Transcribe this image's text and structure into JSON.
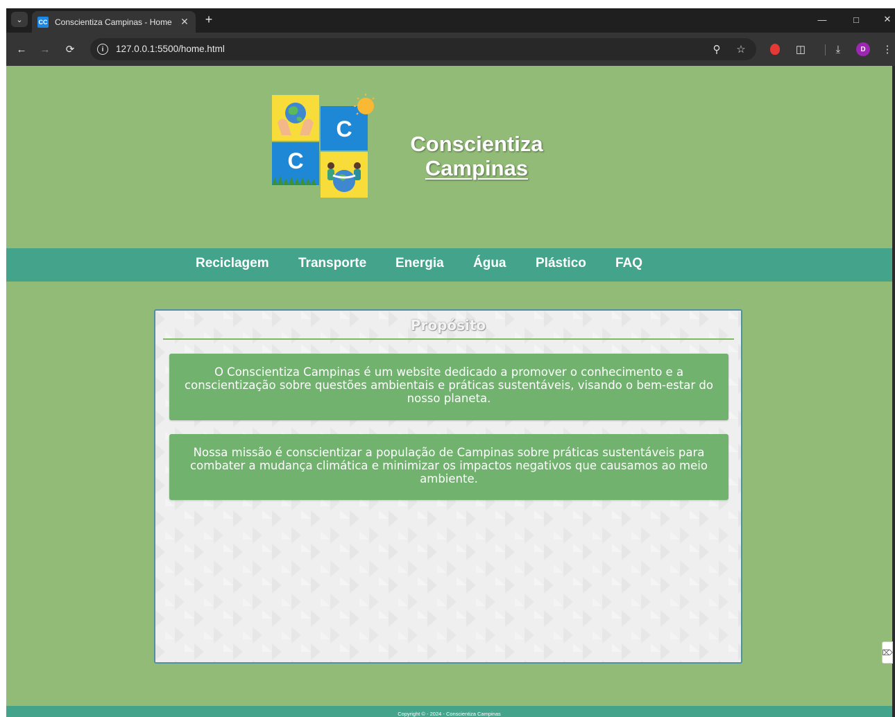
{
  "browser": {
    "tab_title": "Conscientiza Campinas - Home",
    "favicon_text": "CC",
    "url": "127.0.0.1:5500/home.html",
    "profile_initial": "D",
    "icons": {
      "tab_menu": "chevron-down-icon",
      "close_tab": "close-icon",
      "new_tab": "plus-icon",
      "back": "arrow-left-icon",
      "forward": "arrow-right-icon",
      "reload": "reload-icon",
      "site_info": "info-icon",
      "zoom": "zoom-icon",
      "bookmark": "star-icon",
      "extensions": "puzzle-icon",
      "download": "download-icon",
      "menu": "more-vert-icon"
    }
  },
  "site": {
    "title_line1": "Conscientiza",
    "title_line2": "Campinas",
    "logo_letter": "C",
    "nav": [
      "Reciclagem",
      "Transporte",
      "Energia",
      "Água",
      "Plástico",
      "FAQ"
    ],
    "section_title": "Propósito",
    "paragraphs": [
      "O Conscientiza Campinas é um website dedicado a promover o conhecimento e a conscientização sobre questões ambientais e práticas sustentáveis, visando o bem-estar do nosso planeta.",
      "Nossa missão é conscientizar a população de Campinas sobre práticas sustentáveis para combater a mudança climática e minimizar os impactos negativos que causamos ao meio ambiente."
    ],
    "footer": "Copyright © - 2024 - Conscientiza Campinas"
  },
  "colors": {
    "page_background": "#91bb76",
    "nav_background": "#43a48b",
    "card_background": "#eeeeee",
    "card_border": "#4e8fa3",
    "paragraph_box": "#71b26f",
    "title_rule": "#7dbb63",
    "logo_blue": "#1e88d6",
    "logo_yellow": "#f7dc3a"
  }
}
